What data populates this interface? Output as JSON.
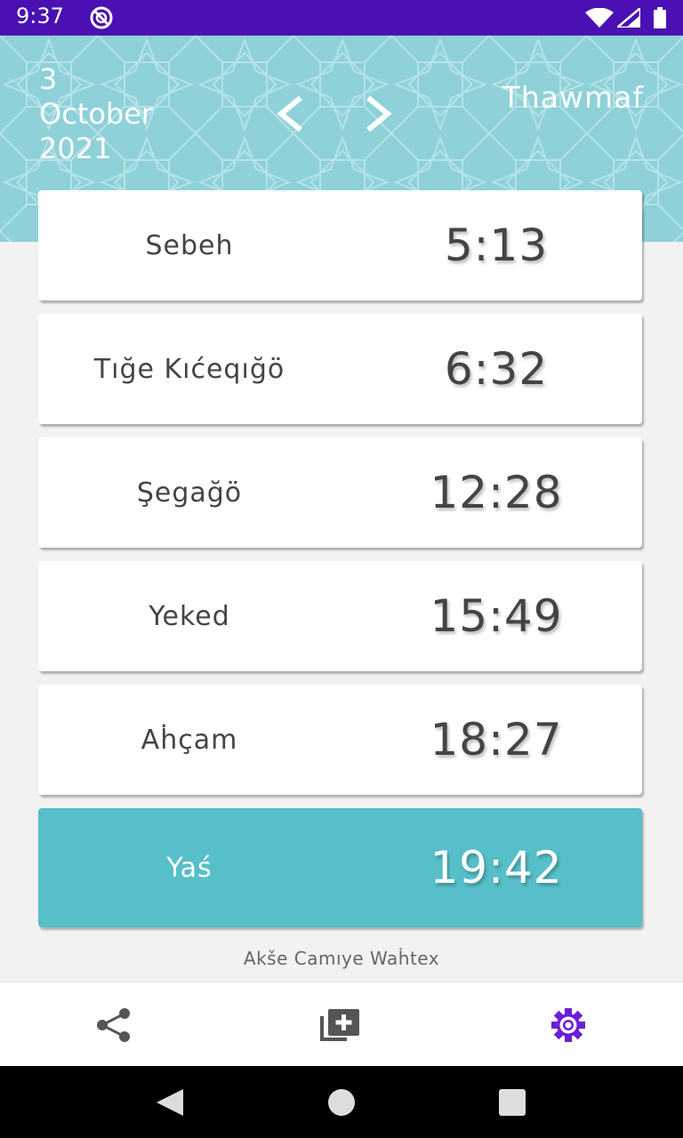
{
  "status_bar": {
    "time": "9:37",
    "background": "#4a10b3"
  },
  "header": {
    "date": {
      "day": "3",
      "month": "October",
      "year": "2021"
    },
    "city": "Thawmaf",
    "prev_icon": "chevron-left-icon",
    "next_icon": "chevron-right-icon",
    "background": "#8fd1d8"
  },
  "prayers": [
    {
      "name": "Sebeh",
      "time": "5:13",
      "active": false
    },
    {
      "name": "Tığe Kıćeqığö",
      "time": "6:32",
      "active": false
    },
    {
      "name": "Şegağö",
      "time": "12:28",
      "active": false
    },
    {
      "name": "Yeked",
      "time": "15:49",
      "active": false
    },
    {
      "name": "Aḣçam",
      "time": "18:27",
      "active": false
    },
    {
      "name": "Yaś",
      "time": "19:42",
      "active": true
    }
  ],
  "footer_text": "Akše Camıye Waḣtex",
  "toolbar": {
    "share_icon": "share-icon",
    "add_icon": "library-add-icon",
    "settings_icon": "gear-icon",
    "accent": "#6a1fd6"
  },
  "colors": {
    "active_card": "#56bfc9",
    "card": "#ffffff",
    "text": "#444444"
  }
}
